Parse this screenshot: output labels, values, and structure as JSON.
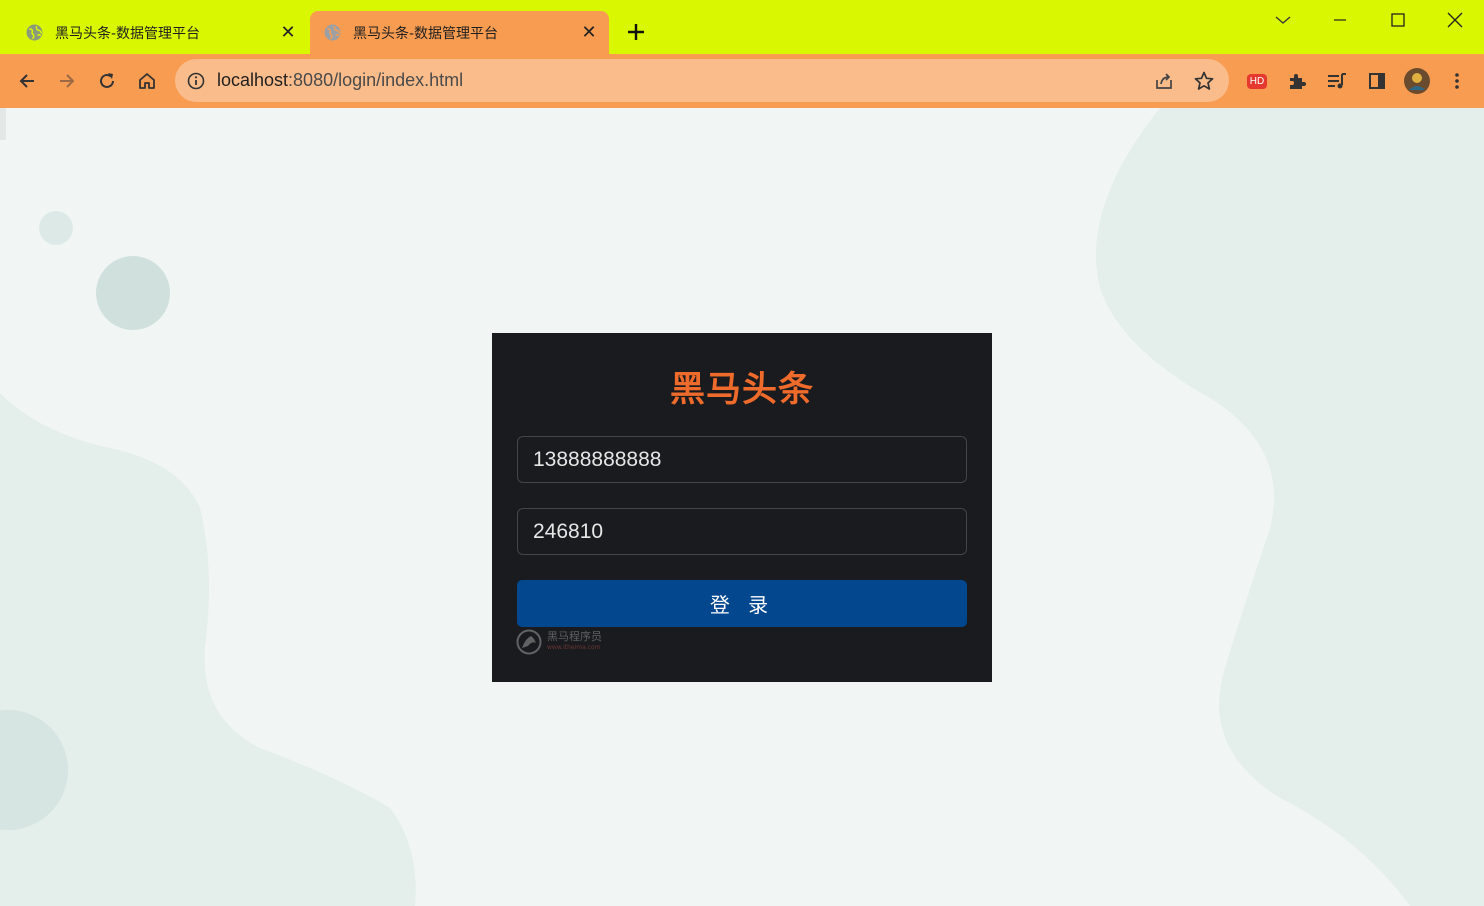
{
  "browser": {
    "tabs": [
      {
        "title": "黑马头条-数据管理平台",
        "active": false
      },
      {
        "title": "黑马头条-数据管理平台",
        "active": true
      }
    ],
    "new_tab_icon": "plus-icon",
    "url_host": "localhost",
    "url_rest": ":8080/login/index.html",
    "extension_badge": "HD",
    "colors": {
      "tabstrip": "#d9f800",
      "toolbar": "#f89c52",
      "omnibox": "#fbbc8c"
    }
  },
  "login": {
    "title": "黑马头条",
    "phone_value": "13888888888",
    "code_value": "246810",
    "button_label": "登 录",
    "watermark_text": "黑马程序员",
    "watermark_sub": "www.itheima.com",
    "colors": {
      "title": "#ef6b2b",
      "button": "#03478f",
      "card": "#1a1b1e"
    }
  }
}
